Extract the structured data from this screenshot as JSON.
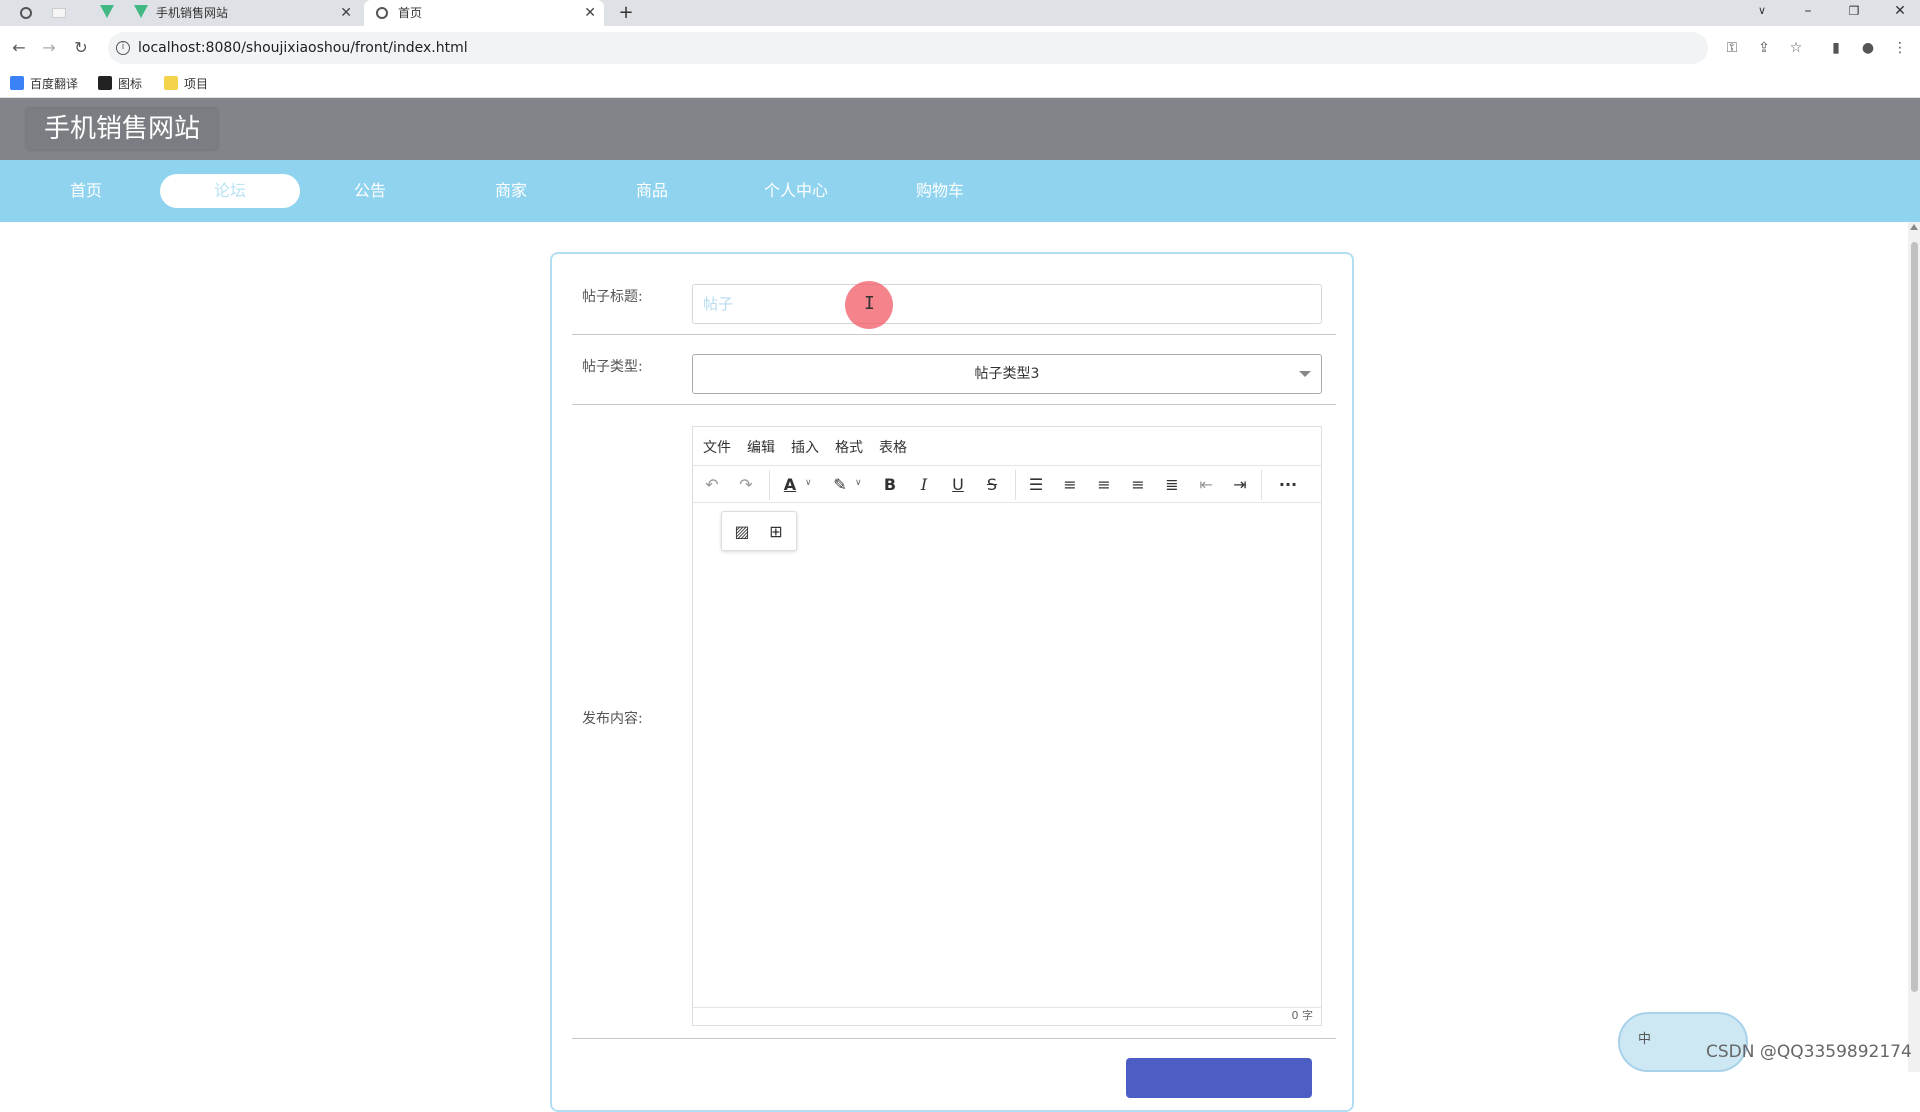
{
  "browser": {
    "tabs": [
      {
        "label": "手机销售网站",
        "active": false
      },
      {
        "label": "首页",
        "active": true
      }
    ],
    "url": "localhost:8080/shoujixiaoshou/front/index.html",
    "bookmarks": [
      "百度翻译",
      "图标",
      "项目"
    ]
  },
  "site": {
    "logo": "手机销售网站",
    "nav": [
      {
        "label": "首页",
        "active": false
      },
      {
        "label": "论坛",
        "active": true
      },
      {
        "label": "公告",
        "active": false
      },
      {
        "label": "商家",
        "active": false
      },
      {
        "label": "商品",
        "active": false
      },
      {
        "label": "个人中心",
        "active": false
      },
      {
        "label": "购物车",
        "active": false
      }
    ]
  },
  "form": {
    "title_label": "帖子标题:",
    "title_value": "帖子",
    "type_label": "帖子类型:",
    "type_value": "帖子类型3",
    "content_label": "发布内容:",
    "editor": {
      "menus": [
        "文件",
        "编辑",
        "插入",
        "格式",
        "表格"
      ],
      "word_count": "0 字"
    }
  },
  "overlay": {
    "ime_label": "中",
    "watermark": "CSDN @QQ3359892174"
  },
  "colors": {
    "header_bg": "#818488",
    "nav_bg": "#8fd3ef",
    "card_border": "#b3def2",
    "submit_bg": "#4c5ec4",
    "cursor_ring": "#f05a64"
  }
}
